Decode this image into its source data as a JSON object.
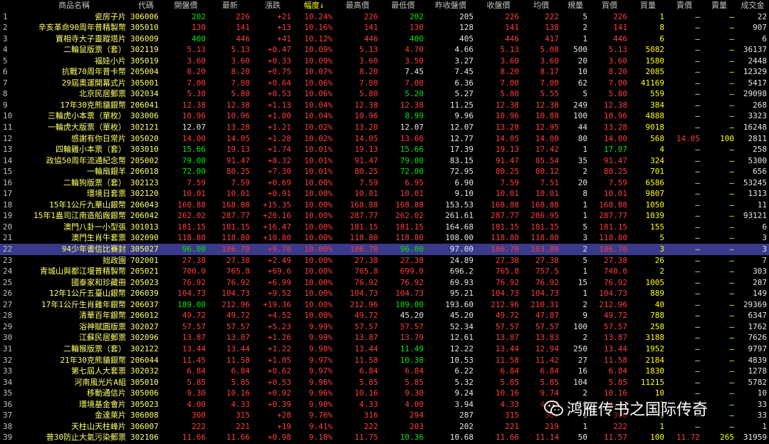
{
  "headers": [
    "",
    "商品名稱",
    "代碼",
    "開盤價",
    "最新",
    "漲跌",
    "幅度↓",
    "最高價",
    "最低價",
    "昨收盤價",
    "收盤價",
    "均價",
    "規量",
    "買價",
    "買量",
    "賣價",
    "賣量",
    "成交金"
  ],
  "colors": {
    "up": "#ff3b3b",
    "down": "#00e600",
    "flat": "#e6e6e6",
    "name": "#ffff66",
    "selected_row_bg": "#3a3a8a"
  },
  "selected_row": 22,
  "rows": [
    [
      "1",
      "瓷房子片",
      "306006",
      "202",
      "226",
      "+21",
      "10.24%",
      "226",
      "202",
      "205",
      "226",
      "222",
      "5",
      "226",
      "1",
      "—",
      "—",
      "22"
    ],
    [
      "2",
      "辛亥革命90周年普精製幣",
      "305010",
      "130",
      "141",
      "+13",
      "10.16%",
      "141",
      "130",
      "128",
      "141",
      "138",
      "2",
      "141",
      "8",
      "—",
      "—",
      "907"
    ],
    [
      "3",
      "寶相寺大子靈蹤塔片",
      "306009",
      "400",
      "446",
      "+41",
      "10.12%",
      "446",
      "400",
      "405",
      "446",
      "417",
      "1",
      "446",
      "6",
      "—",
      "—",
      "6"
    ],
    [
      "4",
      "二輪鼠版票（套）",
      "302119",
      "5.13",
      "5.13",
      "+0.47",
      "10.09%",
      "5.13",
      "4.70",
      "4.66",
      "5.13",
      "5.08",
      "500",
      "5.13",
      "5082",
      "—",
      "—",
      "36137"
    ],
    [
      "5",
      "福娃小片",
      "305019",
      "3.60",
      "3.60",
      "+0.33",
      "10.09%",
      "3.60",
      "3.50",
      "3.27",
      "3.60",
      "3.60",
      "20",
      "3.60",
      "1580",
      "—",
      "—",
      "2448"
    ],
    [
      "6",
      "抗戰70周年普卡幣",
      "205004",
      "8.20",
      "8.20",
      "+0.75",
      "10.07%",
      "8.20",
      "7.45",
      "7.45",
      "8.20",
      "8.17",
      "10",
      "8.20",
      "2085",
      "—",
      "—",
      "12329"
    ],
    [
      "7",
      "29屆奧運開幕式片",
      "305001",
      "7.00",
      "7.00",
      "+0.64",
      "10.06%",
      "7.00",
      "7.00",
      "6.36",
      "7.00",
      "7.00",
      "62",
      "7.00",
      "41169",
      "—",
      "—",
      "5417"
    ],
    [
      "8",
      "北京民居郵票",
      "302034",
      "5.30",
      "5.80",
      "+0.53",
      "10.06%",
      "5.80",
      "5.20",
      "5.27",
      "5.80",
      "5.55",
      "5",
      "5.80",
      "559",
      "—",
      "—",
      "29098"
    ],
    [
      "9",
      "17年30克熊貓銀幣",
      "206041",
      "12.38",
      "12.38",
      "+1.13",
      "10.04%",
      "12.38",
      "12.38",
      "11.25",
      "12.38",
      "12.38",
      "249",
      "12.38",
      "384",
      "—",
      "—",
      "268"
    ],
    [
      "10",
      "三輪虎小本票（單枚）",
      "303006",
      "10.96",
      "10.96",
      "+1.00",
      "10.04%",
      "10.96",
      "8.99",
      "9.96",
      "10.96",
      "10.88",
      "100",
      "10.96",
      "4888",
      "—",
      "—",
      "3323"
    ],
    [
      "11",
      "一輪虎大版票（單枚）",
      "302121",
      "12.07",
      "13.28",
      "+1.21",
      "10.02%",
      "13.28",
      "12.07",
      "12.07",
      "13.28",
      "12.95",
      "44",
      "13.28",
      "9018",
      "—",
      "—",
      "16248"
    ],
    [
      "12",
      "感謝有你日常片",
      "305020",
      "14.00",
      "14.05",
      "+1.28",
      "10.02%",
      "14.05",
      "13.60",
      "12.77",
      "14.05",
      "14.00",
      "80",
      "14.00",
      "568",
      "14.05",
      "100",
      "2811"
    ],
    [
      "13",
      "四輪雞小本票（套）",
      "303010",
      "15.66",
      "19.13",
      "+1.74",
      "10.01%",
      "19.13",
      "15.66",
      "17.39",
      "19.13",
      "17.42",
      "1",
      "17.07",
      "4",
      "—",
      "—",
      "258"
    ],
    [
      "14",
      "政協50周年流通紀念幣",
      "205002",
      "79.00",
      "91.47",
      "+8.32",
      "10.01%",
      "91.47",
      "79.00",
      "83.15",
      "91.47",
      "85.54",
      "35",
      "91.47",
      "324",
      "—",
      "—",
      "5300"
    ],
    [
      "15",
      "一輪扇銀羊",
      "206018",
      "72.00",
      "80.25",
      "+7.30",
      "10.01%",
      "80.25",
      "72.00",
      "72.95",
      "80.25",
      "80.12",
      "2",
      "80.25",
      "701",
      "—",
      "—",
      "656"
    ],
    [
      "16",
      "二輪狗版票（套）",
      "302123",
      "7.59",
      "7.59",
      "+0.69",
      "10.00%",
      "7.59",
      "6.95",
      "6.90",
      "7.59",
      "7.51",
      "20",
      "7.59",
      "6586",
      "—",
      "—",
      "53245"
    ],
    [
      "17",
      "環境日套票",
      "302120",
      "10.01",
      "10.01",
      "+0.91",
      "10.00%",
      "10.01",
      "10.01",
      "9.10",
      "10.01",
      "10.01",
      "8",
      "10.01",
      "9807",
      "—",
      "—",
      "1313"
    ],
    [
      "18",
      "15年1公斤九華山銀幣",
      "206043",
      "168.88",
      "168.88",
      "+15.35",
      "10.00%",
      "168.88",
      "168.88",
      "153.53",
      "168.88",
      "168.88",
      "1",
      "168.88",
      "1050",
      "—",
      "—",
      "11"
    ],
    [
      "19",
      "15年1盎司江南造船廠銀幣",
      "206042",
      "262.02",
      "287.77",
      "+26.16",
      "10.00%",
      "287.77",
      "262.02",
      "261.61",
      "287.77",
      "286.95",
      "1",
      "287.77",
      "1039",
      "—",
      "—",
      "93121"
    ],
    [
      "20",
      "澳門八卦一小型張",
      "301013",
      "181.15",
      "181.15",
      "+16.47",
      "10.00%",
      "181.15",
      "181.15",
      "164.68",
      "181.15",
      "181.15",
      "5",
      "181.15",
      "155",
      "—",
      "—",
      "6"
    ],
    [
      "21",
      "澳門生肖牛套票",
      "302090",
      "118.80",
      "118.80",
      "+10.80",
      "10.00%",
      "118.80",
      "118.80",
      "108.00",
      "118.80",
      "118.80",
      "3",
      "118.80",
      "5",
      "—",
      "—",
      "3"
    ],
    [
      "22",
      "94少年書信比賽封",
      "305027",
      "96.00",
      "106.70",
      "+9.70",
      "10.00%",
      "106.70",
      "96.00",
      "97.00",
      "106.70",
      "103.80",
      "2",
      "106.70",
      "3",
      "—",
      "—",
      "3"
    ],
    [
      "23",
      "拙政園",
      "702001",
      "27.38",
      "27.38",
      "+2.49",
      "10.00%",
      "27.38",
      "27.38",
      "24.89",
      "27.38",
      "27.38",
      "5",
      "27.38",
      "26",
      "—",
      "—",
      "7"
    ],
    [
      "24",
      "青城山與都江堰普精製幣",
      "205021",
      "700.0",
      "765.8",
      "+69.6",
      "10.00%",
      "765.8",
      "699.0",
      "696.2",
      "765.8",
      "757.5",
      "1",
      "740.0",
      "2",
      "—",
      "—",
      "303"
    ],
    [
      "25",
      "國泰家和珍藏冊",
      "205023",
      "76.92",
      "76.92",
      "+6.99",
      "10.00%",
      "76.92",
      "76.92",
      "69.93",
      "76.92",
      "76.92",
      "15",
      "76.92",
      "1005",
      "—",
      "—",
      "287"
    ],
    [
      "26",
      "12年1公斤五臺山銀幣",
      "206039",
      "104.73",
      "104.73",
      "+9.52",
      "10.00%",
      "104.73",
      "104.73",
      "95.21",
      "104.73",
      "104.73",
      "1",
      "104.73",
      "889",
      "—",
      "—",
      "149"
    ],
    [
      "27",
      "17年1公斤生肖雞年銀幣",
      "206037",
      "189.00",
      "212.96",
      "+19.36",
      "10.00%",
      "212.96",
      "189.00",
      "193.60",
      "212.96",
      "210.31",
      "2",
      "212.96",
      "40",
      "—",
      "—",
      "29369"
    ],
    [
      "28",
      "清華百年銀幣",
      "206012",
      "49.72",
      "49.72",
      "+4.52",
      "10.00%",
      "49.72",
      "45.20",
      "45.20",
      "49.72",
      "47.87",
      "9",
      "49.72",
      "788",
      "—",
      "—",
      "6347"
    ],
    [
      "29",
      "浴神賦圓版票",
      "302027",
      "57.57",
      "57.57",
      "+5.23",
      "9.99%",
      "57.57",
      "57.57",
      "52.34",
      "57.57",
      "57.57",
      "100",
      "57.57",
      "258",
      "—",
      "—",
      "1762"
    ],
    [
      "30",
      "江蘇民居郵票",
      "302096",
      "13.87",
      "13.87",
      "+1.26",
      "9.99%",
      "13.87",
      "13.79",
      "12.61",
      "13.87",
      "13.83",
      "2",
      "13.87",
      "3188",
      "—",
      "—",
      "7626"
    ],
    [
      "31",
      "二輪猴版票（套）",
      "302122",
      "13.44",
      "13.44",
      "+1.22",
      "9.98%",
      "13.44",
      "11.49",
      "12.22",
      "13.44",
      "12.94",
      "250",
      "13.44",
      "1952",
      "—",
      "—",
      "9797"
    ],
    [
      "32",
      "21年30克熊貓銀幣",
      "206044",
      "11.45",
      "11.58",
      "+1.05",
      "9.97%",
      "11.58",
      "10.38",
      "10.53",
      "11.58",
      "11.42",
      "27",
      "11.58",
      "2184",
      "—",
      "—",
      "4839"
    ],
    [
      "33",
      "第七屆人大套票",
      "302032",
      "6.84",
      "6.84",
      "+0.62",
      "9.97%",
      "6.84",
      "6.84",
      "6.22",
      "6.84",
      "6.84",
      "16",
      "6.84",
      "1830",
      "—",
      "—",
      "1278"
    ],
    [
      "34",
      "河南風光片A組",
      "305010",
      "5.85",
      "5.85",
      "+0.53",
      "9.96%",
      "5.85",
      "5.85",
      "5.32",
      "5.85",
      "5.85",
      "104",
      "5.85",
      "11215",
      "—",
      "—",
      "5782"
    ],
    [
      "35",
      "移動通信片",
      "305006",
      "9.30",
      "10.16",
      "+0.92",
      "9.96%",
      "10.16",
      "9.30",
      "9.24",
      "10.16",
      "9.74",
      "2",
      "10.16",
      "10",
      "—",
      "—",
      "10"
    ],
    [
      "36",
      "環境基金會片",
      "305023",
      "4.00",
      "4.33",
      "+0.39",
      "9.90%",
      "4.33",
      "4.00",
      "3.94",
      "4.33",
      "4.33",
      "10",
      "4.33",
      "1",
      "—",
      "—",
      "33"
    ],
    [
      "37",
      "金達萊片",
      "306008",
      "300",
      "315",
      "+28",
      "9.76%",
      "316",
      "294",
      "287",
      "315",
      "307",
      "1",
      "300",
      "1",
      "—",
      "—",
      "33"
    ],
    [
      "38",
      "天柱山天柱峰片",
      "306007",
      "222",
      "221",
      "+19",
      "9.41%",
      "222",
      "203",
      "202",
      "221",
      "219",
      "1",
      "222",
      "1",
      "—",
      "—",
      "1"
    ],
    [
      "39",
      "普30防止大氣污染郵票",
      "302106",
      "11.66",
      "11.66",
      "+0.98",
      "9.18%",
      "11.75",
      "10.36",
      "10.68",
      "11.66",
      "11.14",
      "50",
      "11.57",
      "100",
      "11.72",
      "265",
      "31959"
    ]
  ],
  "watermark": {
    "text": "鸿雁传书之国际传奇",
    "icon": "wechat-icon"
  }
}
